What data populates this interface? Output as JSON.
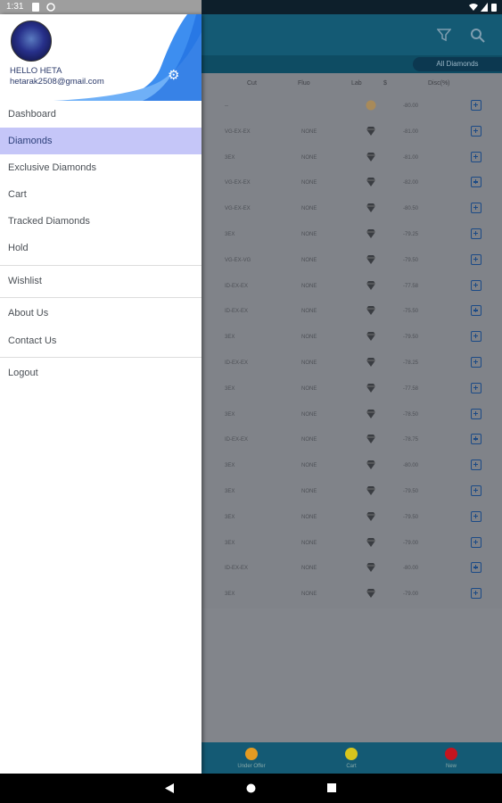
{
  "status_bar": {
    "time": "1:31"
  },
  "background_app": {
    "tab_label": "All Diamonds",
    "columns": [
      "Cut",
      "Fluo",
      "Lab",
      "$",
      "Disc(%)"
    ],
    "rows": [
      {
        "cut": "--",
        "fluo": "",
        "disc": "-80.00"
      },
      {
        "cut": "VG-EX-EX",
        "fluo": "NONE",
        "disc": "-81.00"
      },
      {
        "cut": "3EX",
        "fluo": "NONE",
        "disc": "-81.00"
      },
      {
        "cut": "VG-EX-EX",
        "fluo": "NONE",
        "disc": "-82.00"
      },
      {
        "cut": "VG-EX-EX",
        "fluo": "NONE",
        "disc": "-80.50"
      },
      {
        "cut": "3EX",
        "fluo": "NONE",
        "disc": "-79.25"
      },
      {
        "cut": "VG-EX-VG",
        "fluo": "NONE",
        "disc": "-79.50"
      },
      {
        "cut": "ID-EX-EX",
        "fluo": "NONE",
        "disc": "-77.58"
      },
      {
        "cut": "ID-EX-EX",
        "fluo": "NONE",
        "disc": "-75.50"
      },
      {
        "cut": "3EX",
        "fluo": "NONE",
        "disc": "-79.50"
      },
      {
        "cut": "ID-EX-EX",
        "fluo": "NONE",
        "disc": "-78.25"
      },
      {
        "cut": "3EX",
        "fluo": "NONE",
        "disc": "-77.58"
      },
      {
        "cut": "3EX",
        "fluo": "NONE",
        "disc": "-78.50"
      },
      {
        "cut": "ID-EX-EX",
        "fluo": "NONE",
        "disc": "-78.75"
      },
      {
        "cut": "3EX",
        "fluo": "NONE",
        "disc": "-80.00"
      },
      {
        "cut": "3EX",
        "fluo": "NONE",
        "disc": "-79.50"
      },
      {
        "cut": "3EX",
        "fluo": "NONE",
        "disc": "-79.50"
      },
      {
        "cut": "3EX",
        "fluo": "NONE",
        "disc": "-79.00"
      },
      {
        "cut": "ID-EX-EX",
        "fluo": "NONE",
        "disc": "-80.00"
      },
      {
        "cut": "3EX",
        "fluo": "NONE",
        "disc": "-79.00"
      }
    ],
    "bottom_nav": [
      {
        "label": "Under Offer",
        "color": "#e49b22"
      },
      {
        "label": "Cart",
        "color": "#d8c51d"
      },
      {
        "label": "New",
        "color": "#c4151f"
      }
    ]
  },
  "drawer": {
    "greeting": "HELLO HETA",
    "email": "hetarak2508@gmail.com",
    "menu": [
      {
        "label": "Dashboard"
      },
      {
        "label": "Diamonds"
      },
      {
        "label": "Exclusive Diamonds"
      },
      {
        "label": "Cart"
      },
      {
        "label": "Tracked Diamonds"
      },
      {
        "label": "Hold"
      },
      {
        "label": "Wishlist"
      },
      {
        "label": "About Us"
      },
      {
        "label": "Contact Us"
      },
      {
        "label": "Logout"
      }
    ]
  },
  "colors": {
    "accent": "#145a74",
    "active_item": "#c5c6f8",
    "drawer_wave": "#3d8ef0"
  }
}
